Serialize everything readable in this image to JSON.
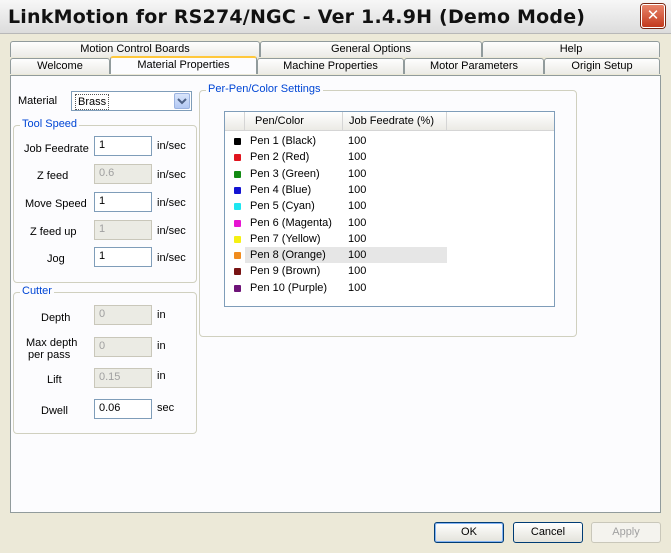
{
  "window": {
    "title": "LinkMotion for RS274/NGC - Ver 1.4.9H (Demo Mode)",
    "close_glyph": "✕"
  },
  "tabs_row1": [
    "Motion Control Boards",
    "General Options",
    "Help"
  ],
  "tabs_row2": [
    "Welcome",
    "Material Properties",
    "Machine Properties",
    "Motor Parameters",
    "Origin Setup"
  ],
  "active_tab": "Material Properties",
  "material": {
    "label": "Material",
    "value": "Brass"
  },
  "tool_speed": {
    "title": "Tool Speed",
    "rows": [
      {
        "label": "Job Feedrate",
        "value": "1",
        "unit": "in/sec",
        "disabled": false
      },
      {
        "label": "Z feed",
        "value": "0.6",
        "unit": "in/sec",
        "disabled": true
      },
      {
        "label": "Move Speed",
        "value": "1",
        "unit": "in/sec",
        "disabled": false
      },
      {
        "label": "Z feed up",
        "value": "1",
        "unit": "in/sec",
        "disabled": true
      },
      {
        "label": "Jog",
        "value": "1",
        "unit": "in/sec",
        "disabled": false
      }
    ]
  },
  "cutter": {
    "title": "Cutter",
    "depth": {
      "label": "Depth",
      "value": "0",
      "unit": "in"
    },
    "max_depth": {
      "label_line1": "Max depth",
      "label_line2": "per pass",
      "value": "0",
      "unit": "in"
    },
    "lift": {
      "label": "Lift",
      "value": "0.15",
      "unit": "in"
    },
    "dwell": {
      "label": "Dwell",
      "value": "0.06",
      "unit": "sec"
    }
  },
  "pen_settings": {
    "title": "Per-Pen/Color Settings",
    "col_pen": "Pen/Color",
    "col_rate": "Job Feedrate (%)",
    "selected_index": 7,
    "pens": [
      {
        "name": "Pen 1  (Black)",
        "rate": "100",
        "color": "#000000"
      },
      {
        "name": "Pen 2  (Red)",
        "rate": "100",
        "color": "#e0141e"
      },
      {
        "name": "Pen 3  (Green)",
        "rate": "100",
        "color": "#128a12"
      },
      {
        "name": "Pen 4  (Blue)",
        "rate": "100",
        "color": "#1414d2"
      },
      {
        "name": "Pen 5  (Cyan)",
        "rate": "100",
        "color": "#1ee6f0"
      },
      {
        "name": "Pen 6  (Magenta)",
        "rate": "100",
        "color": "#e614d2"
      },
      {
        "name": "Pen 7  (Yellow)",
        "rate": "100",
        "color": "#f5f014"
      },
      {
        "name": "Pen 8  (Orange)",
        "rate": "100",
        "color": "#f08c1e"
      },
      {
        "name": "Pen 9  (Brown)",
        "rate": "100",
        "color": "#781414"
      },
      {
        "name": "Pen 10  (Purple)",
        "rate": "100",
        "color": "#6e1478"
      }
    ]
  },
  "buttons": {
    "ok": "OK",
    "cancel": "Cancel",
    "apply": "Apply"
  }
}
